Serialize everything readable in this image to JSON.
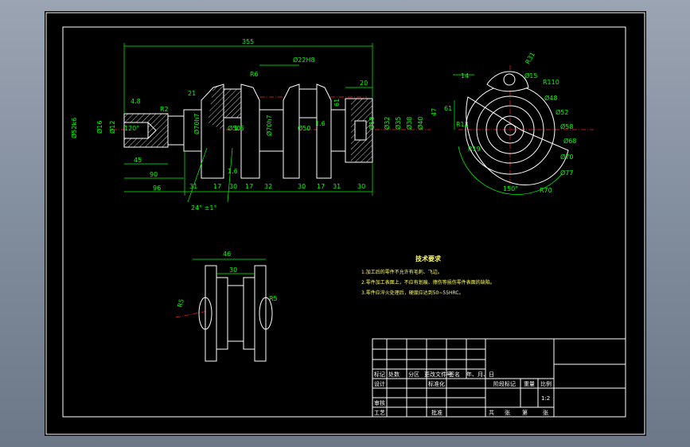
{
  "dims": {
    "total_length": "355",
    "d22": "Ø22H8",
    "r6": "R6",
    "v20": "20",
    "v21": "21",
    "v4_8": "4.8",
    "v1_6a": "1.6",
    "v1_6b": "1.6",
    "v1_6c": "1.6",
    "d52": "Ø52k6",
    "d16": "Ø16",
    "d12": "Ø12",
    "v120": "120°",
    "v45": "45",
    "v90": "90",
    "v96": "96",
    "bot": [
      "31",
      "17",
      "30",
      "17",
      "32",
      "30",
      "17",
      "31",
      "30"
    ],
    "angle": "24° ±1°",
    "d70a": "Ø70h7",
    "d70b": "Ø70h7",
    "d50a": "Ø50",
    "d50b": "Ø50",
    "r_small": "R2",
    "v61": "61",
    "d18": "Ø18",
    "d32": "Ø32",
    "d35": "Ø35",
    "d38": "Ø38",
    "d40": "Ø40",
    "v47": "47"
  },
  "side_dims": {
    "r31": "R31",
    "d15": "Ø15",
    "r110": "R110",
    "d48": "Ø48",
    "d52": "Ø52",
    "d58": "Ø58",
    "d68": "Ø68",
    "d70": "Ø70",
    "d77": "Ø77",
    "v14": "14",
    "v61": "61",
    "r13": "R13",
    "r19": "R19",
    "angle": "150°",
    "r70": "R70"
  },
  "bottom_dims": {
    "w46": "46",
    "w30": "30",
    "r5a": "R5",
    "r5b": "R5"
  },
  "notes": {
    "title": "技术要求",
    "items": [
      "1.加工后的零件不允许有毛刺、飞边。",
      "2.零件加工表面上，不应有划痕、擦伤等损伤零件表面的缺陷。",
      "3.零件应淬火处理后，硬度应达到50~55HRC。"
    ]
  },
  "titleblock": {
    "row_labels": [
      "标记",
      "处数",
      "分区",
      "更改文件号",
      "签名",
      "年、月、日"
    ],
    "design": "设计",
    "std": "标准化",
    "review": "审核",
    "process": "工艺",
    "approve": "批准",
    "stage": "阶段标记",
    "weight": "重量",
    "scale": "比例",
    "scale_val": "1:2",
    "sheets": [
      "共",
      "张",
      "第",
      "张"
    ]
  }
}
